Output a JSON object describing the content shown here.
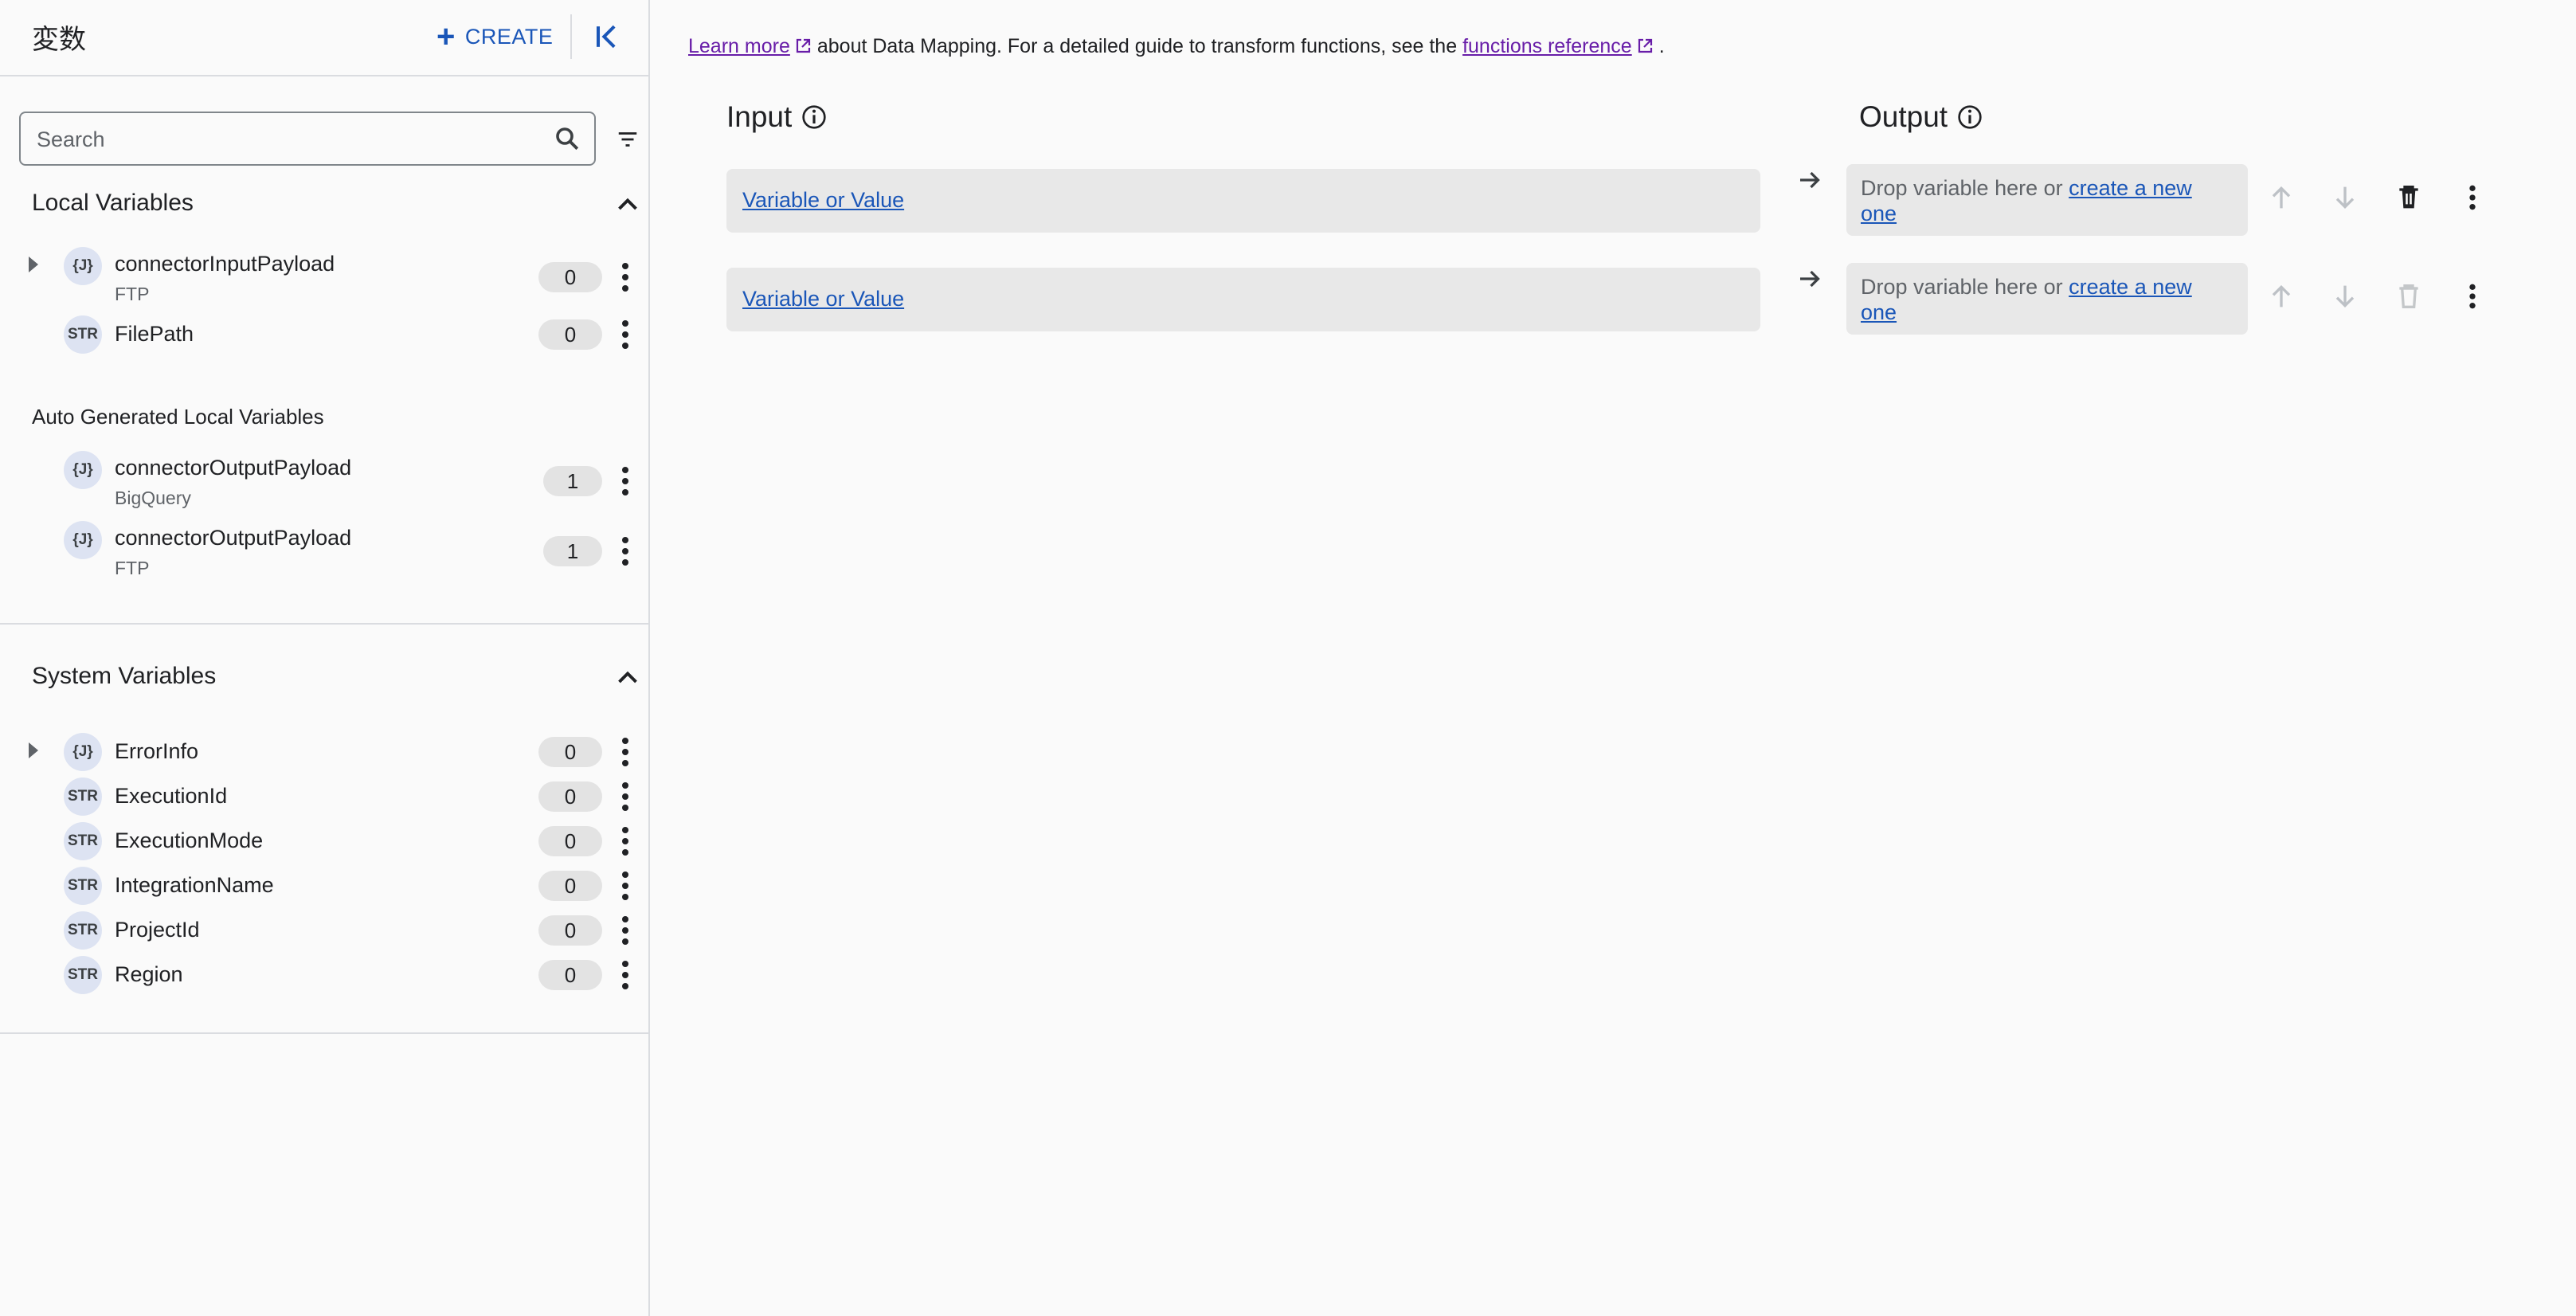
{
  "sidebar": {
    "title": "変数",
    "create_label": "CREATE",
    "search_placeholder": "Search",
    "local": {
      "title": "Local Variables",
      "items": [
        {
          "type": "{J}",
          "name": "connectorInputPayload",
          "sub": "FTP",
          "count": "0"
        },
        {
          "type": "STR",
          "name": "FilePath",
          "sub": "",
          "count": "0"
        }
      ]
    },
    "auto": {
      "title": "Auto Generated Local Variables",
      "items": [
        {
          "type": "{J}",
          "name": "connectorOutputPayload",
          "sub": "BigQuery",
          "count": "1"
        },
        {
          "type": "{J}",
          "name": "connectorOutputPayload",
          "sub": "FTP",
          "count": "1"
        }
      ]
    },
    "system": {
      "title": "System Variables",
      "items": [
        {
          "type": "{J}",
          "name": "ErrorInfo",
          "count": "0"
        },
        {
          "type": "STR",
          "name": "ExecutionId",
          "count": "0"
        },
        {
          "type": "STR",
          "name": "ExecutionMode",
          "count": "0"
        },
        {
          "type": "STR",
          "name": "IntegrationName",
          "count": "0"
        },
        {
          "type": "STR",
          "name": "ProjectId",
          "count": "0"
        },
        {
          "type": "STR",
          "name": "Region",
          "count": "0"
        }
      ]
    }
  },
  "main": {
    "info": {
      "learn_more": "Learn more",
      "middle": "about Data Mapping. For a detailed guide to transform functions, see the",
      "functions_ref": "functions reference",
      "end": "."
    },
    "input_title": "Input",
    "output_title": "Output",
    "rows": [
      {
        "input": "Variable or Value",
        "output_text": "Drop variable here or",
        "output_link": "create a new one"
      },
      {
        "input": "Variable or Value",
        "output_text": "Drop variable here or",
        "output_link": "create a new one"
      }
    ]
  },
  "colors": {
    "accent": "#1a56b8",
    "link_visited": "#681da8",
    "badge_bg": "#dde3f2"
  },
  "icons": [
    "plus-icon",
    "collapse-left-icon",
    "search-icon",
    "filter-icon",
    "chevron-up-icon",
    "expand-arrow-icon",
    "more-vert-icon",
    "external-link-icon",
    "info-icon",
    "arrow-right-icon",
    "arrow-up-icon",
    "arrow-down-icon",
    "delete-icon"
  ]
}
